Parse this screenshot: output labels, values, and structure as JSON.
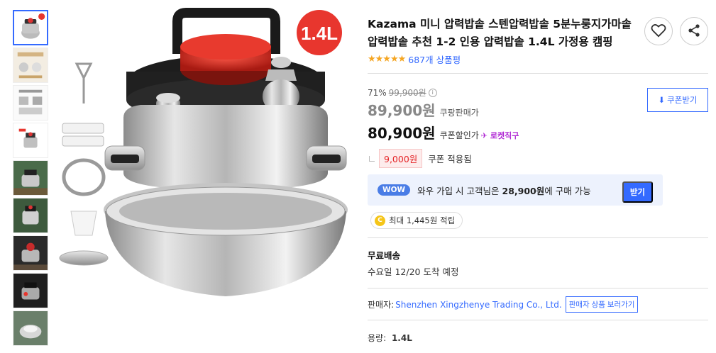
{
  "product": {
    "title": "Kazama 미니 압력밥솥 스텐압력밥솥 5분누룽지가마솥 압력밥솥 추천 1-2 인용 압력밥솥 1.4L 가정용 캠핑",
    "size_badge": "1.4L",
    "stars": "★★★★★",
    "rating_fraction": 0.9,
    "review_count": "687개 상품평"
  },
  "actions": {
    "wishlist_icon": "heart-icon",
    "share_icon": "share-icon"
  },
  "price": {
    "discount_rate": "71%",
    "original_price": "99,900원",
    "info_mark": "i",
    "sale_price": "89,900원",
    "sale_label": "쿠팡판매가",
    "coupon_price": "80,900원",
    "coupon_label": "쿠폰할인가",
    "rocket_label": "로켓직구",
    "coupon_button": "쿠폰받기",
    "applied_amount": "9,000원",
    "applied_label": "쿠폰 적용됨"
  },
  "wow": {
    "badge": "WOW",
    "text_prefix": "와우 가입 시 고객님은 ",
    "text_price": "28,900원",
    "text_suffix": "에 구매 가능",
    "button": "받기"
  },
  "points": {
    "coin": "C",
    "text": "최대 1,445원 적립"
  },
  "shipping": {
    "title": "무료배송",
    "date": "수요일 12/20 도착 예정"
  },
  "seller": {
    "label": "판매자:",
    "name": "Shenzhen Xingzhenye Trading Co., Ltd.",
    "button": "판매자 상품 보러가기"
  },
  "option": {
    "label": "용량:",
    "value": "1.4L"
  },
  "colors": {
    "accent": "#346aff",
    "badge_red": "#e8362e",
    "discount_red": "#e52528",
    "star": "#f5a623",
    "rocket": "#b02ad4"
  }
}
